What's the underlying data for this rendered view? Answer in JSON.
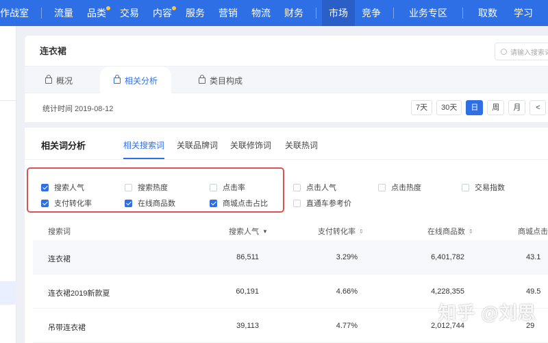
{
  "topnav": {
    "items": [
      {
        "label": "作战室",
        "dot": false,
        "active": false
      },
      {
        "label": "流量",
        "dot": false,
        "active": false
      },
      {
        "label": "品类",
        "dot": true,
        "active": false
      },
      {
        "label": "交易",
        "dot": false,
        "active": false
      },
      {
        "label": "内容",
        "dot": true,
        "active": false
      },
      {
        "label": "服务",
        "dot": false,
        "active": false
      },
      {
        "label": "营销",
        "dot": false,
        "active": false
      },
      {
        "label": "物流",
        "dot": false,
        "active": false
      },
      {
        "label": "财务",
        "dot": false,
        "active": false
      },
      {
        "label": "市场",
        "dot": false,
        "active": true
      },
      {
        "label": "竞争",
        "dot": false,
        "active": false
      },
      {
        "label": "业务专区",
        "dot": false,
        "active": false
      },
      {
        "label": "取数",
        "dot": false,
        "active": false
      },
      {
        "label": "学习",
        "dot": false,
        "active": false
      }
    ]
  },
  "header": {
    "title": "连衣裙",
    "search_placeholder": "请输入搜索词",
    "tabs": [
      {
        "label": "概况",
        "active": false
      },
      {
        "label": "相关分析",
        "active": true
      },
      {
        "label": "类目构成",
        "active": false
      }
    ],
    "stat_time": "统计时间 2019-08-12",
    "date_buttons": [
      {
        "label": "7天",
        "active": false
      },
      {
        "label": "30天",
        "active": false
      },
      {
        "label": "日",
        "active": true
      },
      {
        "label": "周",
        "active": false
      },
      {
        "label": "月",
        "active": false
      },
      {
        "label": "<",
        "active": false
      },
      {
        "label": "<",
        "active": false
      }
    ]
  },
  "analysis": {
    "title": "相关词分析",
    "subtabs": [
      {
        "label": "相关搜索词",
        "active": true
      },
      {
        "label": "关联品牌词",
        "active": false
      },
      {
        "label": "关联修饰词",
        "active": false
      },
      {
        "label": "关联热词",
        "active": false
      }
    ],
    "metrics": [
      {
        "label": "搜索人气",
        "checked": true
      },
      {
        "label": "搜索热度",
        "checked": false
      },
      {
        "label": "点击率",
        "checked": false
      },
      {
        "label": "点击人气",
        "checked": false
      },
      {
        "label": "点击热度",
        "checked": false
      },
      {
        "label": "交易指数",
        "checked": false
      },
      {
        "label": "支付转化率",
        "checked": true
      },
      {
        "label": "在线商品数",
        "checked": true
      },
      {
        "label": "商城点击占比",
        "checked": true
      },
      {
        "label": "直通车参考价",
        "checked": false
      }
    ],
    "table": {
      "columns": [
        {
          "label": "搜索词",
          "sort": ""
        },
        {
          "label": "搜索人气",
          "sort": "▼"
        },
        {
          "label": "支付转化率",
          "sort": "⇕"
        },
        {
          "label": "在线商品数",
          "sort": "⇕"
        },
        {
          "label": "商城点击占比",
          "sort": ""
        }
      ],
      "rows": [
        {
          "keyword": "连衣裙",
          "search_popularity": "86,511",
          "pay_conversion": "3.29%",
          "online_items": "6,401,782",
          "mall_click_ratio": "43.1"
        },
        {
          "keyword": "连衣裙2019新款夏",
          "search_popularity": "60,191",
          "pay_conversion": "4.66%",
          "online_items": "4,228,355",
          "mall_click_ratio": "49.5"
        },
        {
          "keyword": "吊带连衣裙",
          "search_popularity": "39,113",
          "pay_conversion": "4.77%",
          "online_items": "2,012,744",
          "mall_click_ratio": "29"
        }
      ]
    }
  },
  "watermark": "知乎 @刘思"
}
